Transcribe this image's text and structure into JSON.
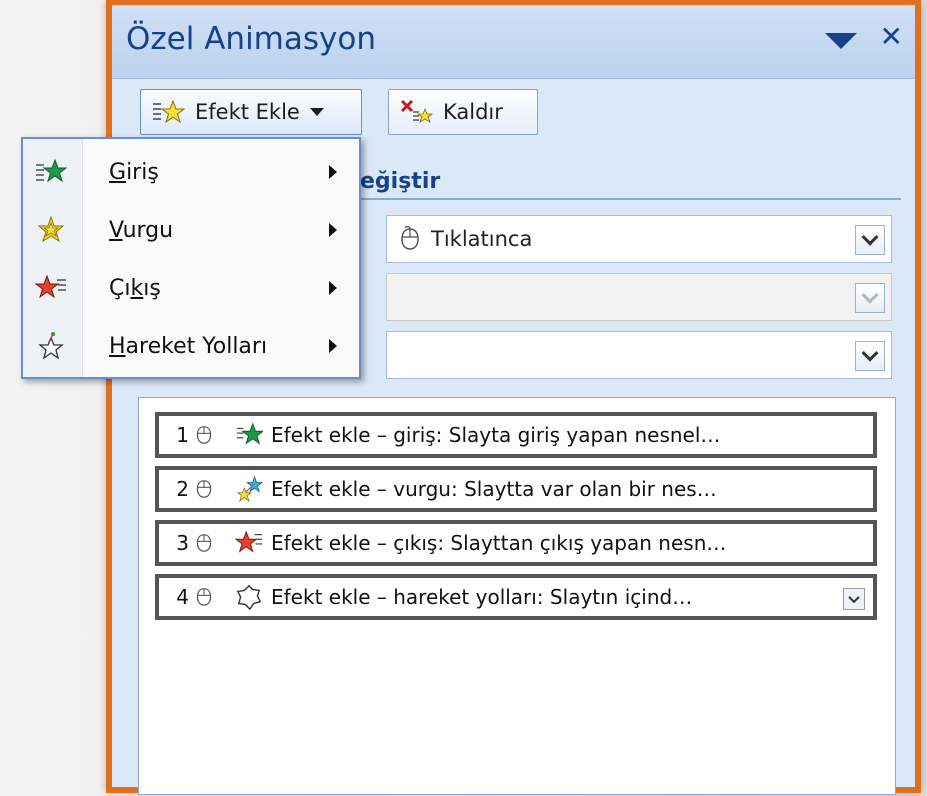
{
  "panel": {
    "title": "Özel Animasyon"
  },
  "toolbar": {
    "add_effect_label": "Efekt Ekle",
    "remove_label": "Kaldır"
  },
  "section": {
    "header_visible": "eğiştir"
  },
  "fields": {
    "start_value": "Tıklatınca",
    "property_value": "",
    "speed_value": ""
  },
  "menu": {
    "items": [
      {
        "pre": "",
        "key": "G",
        "rest": "iriş",
        "icon": "entrance-star-icon"
      },
      {
        "pre": "",
        "key": "V",
        "rest": "urgu",
        "icon": "emphasis-star-icon"
      },
      {
        "pre": "Çı",
        "key": "k",
        "rest": "ış",
        "icon": "exit-star-icon"
      },
      {
        "pre": "",
        "key": "H",
        "rest": "areket Yolları",
        "icon": "motion-path-star-icon"
      }
    ]
  },
  "effects": [
    {
      "num": "1",
      "text": "Efekt ekle – giriş: Slayta  giriş yapan nesnel…",
      "icon": "entrance-star-icon"
    },
    {
      "num": "2",
      "text": "Efekt ekle – vurgu: Slaytta  var olan bir nes…",
      "icon": "emphasis-star-icon"
    },
    {
      "num": "3",
      "text": "Efekt ekle – çıkış: Slayttan çıkış yapan nesn…",
      "icon": "exit-star-icon"
    },
    {
      "num": "4",
      "text": "Efekt ekle – hareket yolları: Slaytın içind…",
      "icon": "motion-path-icon"
    }
  ],
  "colors": {
    "accent_border": "#e06f1f",
    "title_text": "#15428b",
    "entrance": "#1f9a4a",
    "emphasis": "#f2d21b",
    "exit": "#e2432a"
  }
}
